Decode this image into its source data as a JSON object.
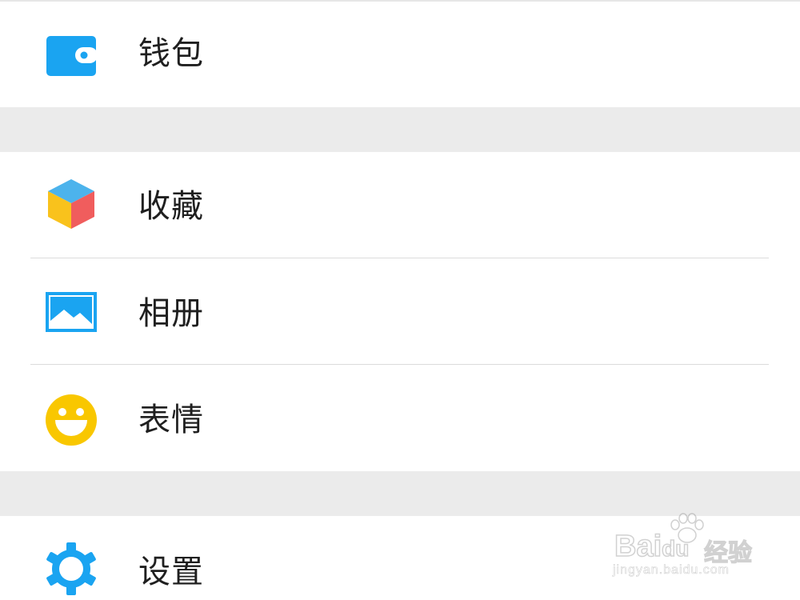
{
  "menu": {
    "wallet": {
      "label": "钱包",
      "icon": "wallet-icon",
      "color": "#1aa4f1"
    },
    "favorites": {
      "label": "收藏",
      "icon": "favorites-cube-icon",
      "colors": [
        "#4cb3ec",
        "#f9c21c",
        "#f05d5d"
      ]
    },
    "album": {
      "label": "相册",
      "icon": "album-picture-icon",
      "color": "#1aa4f1"
    },
    "emoji": {
      "label": "表情",
      "icon": "emoji-smile-icon",
      "color": "#f9c700"
    },
    "settings": {
      "label": "设置",
      "icon": "gear-icon",
      "color": "#1aa4f1"
    }
  },
  "watermark": {
    "brand": "Bai",
    "brand_du": "du",
    "sub": "经验",
    "url": "jingyan.baidu.com"
  }
}
